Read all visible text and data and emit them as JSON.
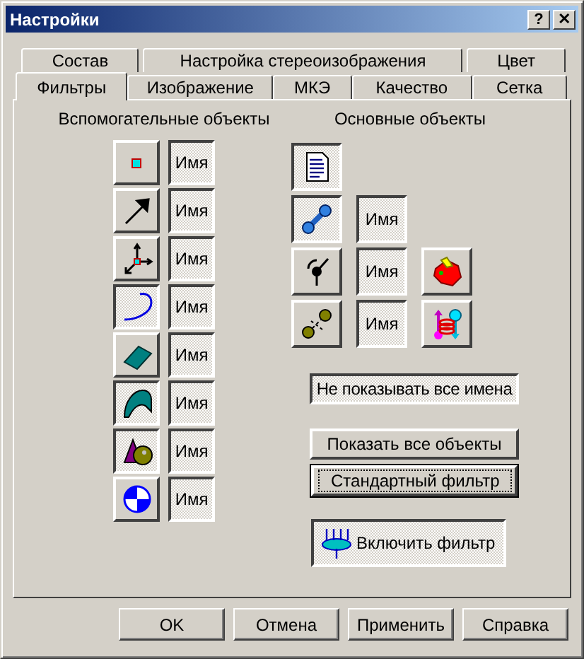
{
  "window": {
    "title": "Настройки",
    "help": "?",
    "close": "✕"
  },
  "tab_rows": [
    [
      {
        "label": "Состав",
        "selected": false
      },
      {
        "label": "Настройка стереоизображения",
        "selected": false
      },
      {
        "label": "Цвет",
        "selected": false
      }
    ],
    [
      {
        "label": "Фильтры",
        "selected": true
      },
      {
        "label": "Изображение",
        "selected": false
      },
      {
        "label": "МКЭ",
        "selected": false
      },
      {
        "label": "Качество",
        "selected": false
      },
      {
        "label": "Сетка",
        "selected": false
      }
    ]
  ],
  "auxiliary_objects": {
    "title": "Вспомогательные объекты",
    "items": [
      {
        "kind": "point",
        "pressed": false,
        "name": {
          "label": "Имя",
          "pressed": true
        }
      },
      {
        "kind": "vector",
        "pressed": false,
        "name": {
          "label": "Имя",
          "pressed": true
        }
      },
      {
        "kind": "axes",
        "pressed": false,
        "name": {
          "label": "Имя",
          "pressed": true
        }
      },
      {
        "kind": "curve",
        "pressed": true,
        "name": {
          "label": "Имя",
          "pressed": true
        }
      },
      {
        "kind": "surface",
        "pressed": false,
        "name": {
          "label": "Имя",
          "pressed": true
        }
      },
      {
        "kind": "shell",
        "pressed": true,
        "name": {
          "label": "Имя",
          "pressed": true
        }
      },
      {
        "kind": "solids",
        "pressed": true,
        "name": {
          "label": "Имя",
          "pressed": true
        }
      },
      {
        "kind": "disc",
        "pressed": false,
        "name": {
          "label": "Имя",
          "pressed": true
        }
      }
    ]
  },
  "main_objects": {
    "title": "Основные объекты",
    "rows": [
      [
        {
          "kind": "document",
          "pressed": true
        }
      ],
      [
        {
          "kind": "link",
          "pressed": true
        },
        {
          "kind": "name",
          "label": "Имя",
          "pressed": true
        }
      ],
      [
        {
          "kind": "sensor",
          "pressed": false
        },
        {
          "kind": "name",
          "label": "Имя",
          "pressed": true
        },
        {
          "kind": "body",
          "pressed": false
        }
      ],
      [
        {
          "kind": "nodes",
          "pressed": false
        },
        {
          "kind": "name",
          "label": "Имя",
          "pressed": true
        },
        {
          "kind": "spring",
          "pressed": false
        }
      ]
    ]
  },
  "hide_names_button": {
    "label": "Не показывать все имена",
    "pressed": true
  },
  "show_all_button": {
    "label": "Показать все объекты",
    "pressed": false
  },
  "standard_filter_button": {
    "label": "Стандартный фильтр",
    "default": true
  },
  "enable_filter_button": {
    "label": "Включить фильтр",
    "pressed": true
  },
  "buttons": [
    "OK",
    "Отмена",
    "Применить",
    "Справка"
  ]
}
